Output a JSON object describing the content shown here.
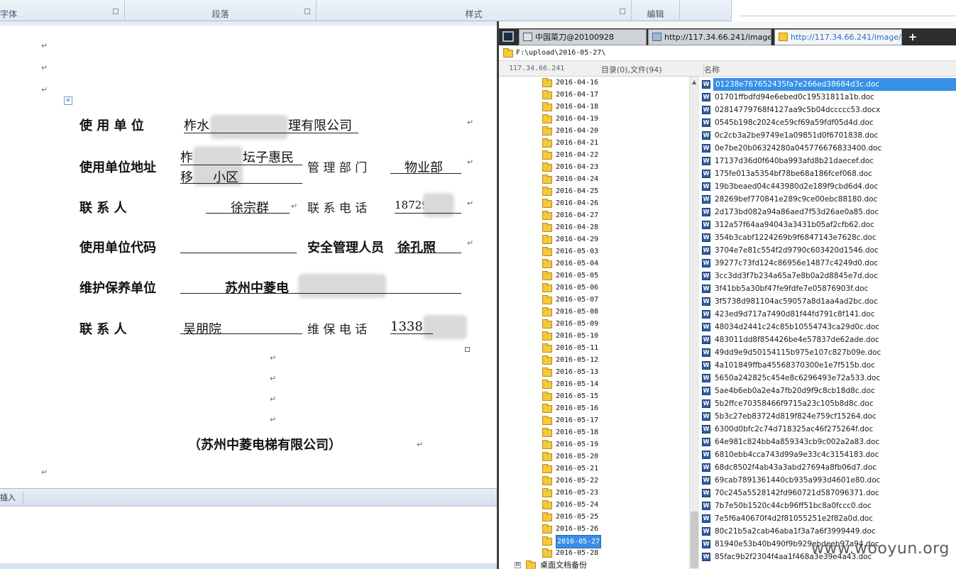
{
  "ribbon": {
    "groups": [
      "字体",
      "段落",
      "样式",
      "编辑"
    ]
  },
  "document": {
    "row1": {
      "label": "使  用  单  位",
      "value_start": "柞水",
      "value_end": "理有限公司"
    },
    "row2": {
      "label": "使用单位地址",
      "addr_line1_a": "柞",
      "addr_line1_b": "坛子惠民",
      "addr_line2_a": "移",
      "addr_line2_b": "小区",
      "mid_label": "管  理  部  门",
      "value": "物业部"
    },
    "row3": {
      "label": "联      系      人",
      "value": "徐宗群",
      "mid_label": "联  系  电  话",
      "phone": "18729"
    },
    "row4": {
      "label": "使用单位代码",
      "value": "",
      "mid_label": "安全管理人员",
      "value2": "徐孔照"
    },
    "row5": {
      "label": "维护保养单位",
      "value": "苏州中菱电"
    },
    "row6": {
      "label": "联      系      人",
      "value": "吴朋院",
      "mid_label": "维  保  电  话",
      "phone": "1338"
    },
    "footer_company": "（苏州中菱电梯有限公司）",
    "para_mark": "↵",
    "table_handle": "+"
  },
  "status_bar": {
    "mode": "插入"
  },
  "chopper": {
    "tabs": [
      {
        "label": "中国菜刀@20100928",
        "icon": "window-icon"
      },
      {
        "label": "http://117.34.66.241/image/...",
        "icon": "folder-icon"
      },
      {
        "label": "http://117.34.66.241/image/...",
        "icon": "folder-icon"
      }
    ],
    "add_tab": "+",
    "path": "F:\\upload\\2016-05-27\\",
    "server_ip": "117.34.66.241",
    "summary": "目录(0),文件(94)",
    "column_name": "名称",
    "tree": [
      "2016-04-16",
      "2016-04-17",
      "2016-04-18",
      "2016-04-19",
      "2016-04-20",
      "2016-04-21",
      "2016-04-22",
      "2016-04-23",
      "2016-04-24",
      "2016-04-25",
      "2016-04-26",
      "2016-04-27",
      "2016-04-28",
      "2016-04-29",
      "2016-05-03",
      "2016-05-04",
      "2016-05-05",
      "2016-05-06",
      "2016-05-07",
      "2016-05-08",
      "2016-05-09",
      "2016-05-10",
      "2016-05-11",
      "2016-05-12",
      "2016-05-13",
      "2016-05-14",
      "2016-05-15",
      "2016-05-16",
      "2016-05-17",
      "2016-05-18",
      "2016-05-19",
      "2016-05-20",
      "2016-05-21",
      "2016-05-22",
      "2016-05-23",
      "2016-05-24",
      "2016-05-25",
      "2016-05-26",
      "2016-05-27",
      "2016-05-28"
    ],
    "tree_selected": "2016-05-27",
    "tree_sub": {
      "label": "桌面文档备份",
      "expander": "⊟"
    },
    "files": [
      "01238e767652435fa7e266ed38684d3c.doc",
      "01701ffbdfd94e6ebed0c19531811a1b.doc",
      "02814779768f4127aa9c5b04dccccc53.docx",
      "0545b198c2024ce59cf69a59fdf05d4d.doc",
      "0c2cb3a2be9749e1a09851d0f6701838.doc",
      "0e7be20b06324280a045776676833400.doc",
      "17137d36d0f640ba993afd8b21daecef.doc",
      "175fe013a5354bf78be68a186fcef068.doc",
      "19b3beaed04c443980d2e189f9cbd6d4.doc",
      "28269bef770841e289c9ce00ebc88180.doc",
      "2d173bd082a94a86aed7f53d26ae0a85.doc",
      "312a57f64aa94043a3431b05af2cfb62.doc",
      "354b3cabf1224269b9f6847143e7628c.doc",
      "3704e7e81c554f2d9790c603420d1546.doc",
      "39277c73fd124c86956e14877c4249d0.doc",
      "3cc3dd3f7b234a65a7e8b0a2d8845e7d.doc",
      "3f41bb5a30bf47fe9fdfe7e05876903f.doc",
      "3f5738d981104ac59057a8d1aa4ad2bc.doc",
      "423ed9d717a7490d81f44fd791c8f141.doc",
      "48034d2441c24c85b10554743ca29d0c.doc",
      "483011dd8f854426be4e57837de62ade.doc",
      "49dd9e9d50154115b975e107c827b09e.doc",
      "4a101849ffba45568370300e1e7f515b.doc",
      "5650a242825c454e8c6296493e72a533.doc",
      "5ae4b6eb0a2e4a7fb20d9f9c8cb18d8c.doc",
      "5b2ffce70358466f9715a23c105b8d8c.doc",
      "5b3c27eb83724d819f824e759cf15264.doc",
      "6300d0bfc2c74d718325ac46f275264f.doc",
      "64e981c824bb4a859343cb9c002a2a83.doc",
      "6810ebb4cca743d99a9e33c4c3154183.doc",
      "68dc8502f4ab43a3abd27694a8fb06d7.doc",
      "69cab7891361440cb935a993d4601e80.doc",
      "70c245a5528142fd960721d587096371.doc",
      "7b7e50b1520c44cb96ff51bc8a0fccc0.doc",
      "7e5f6a40670f4d2f81055251e2f82a0d.doc",
      "80c21b5a2cab46aba1f3a7a6f3999449.doc",
      "81940e53b40b490f9b929ebdeeb97a94.doc",
      "85fac9b2f2304f4aa1f468a3e39e4a43.doc"
    ],
    "file_selected": "01238e767652435fa7e266ed38684d3c.doc"
  },
  "watermark": "www.wooyun.org"
}
